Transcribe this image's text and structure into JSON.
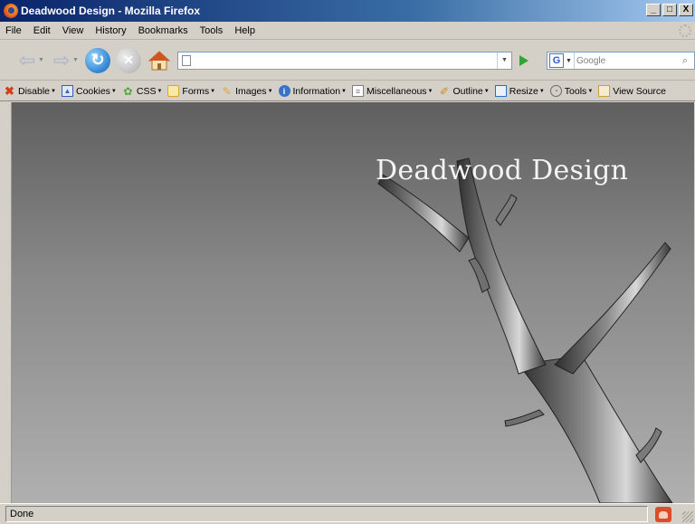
{
  "window": {
    "title": "Deadwood Design - Mozilla Firefox",
    "controls": [
      "_",
      "□",
      "X"
    ]
  },
  "menu": {
    "items": [
      "File",
      "Edit",
      "View",
      "History",
      "Bookmarks",
      "Tools",
      "Help"
    ]
  },
  "navigation": {
    "url_value": "",
    "search_placeholder": "Google",
    "search_engine_icon": "google-icon"
  },
  "dev_toolbar": {
    "items": [
      {
        "label": "Disable",
        "icon": "disable-icon",
        "color": "#d83c1b"
      },
      {
        "label": "Cookies",
        "icon": "cookies-icon",
        "color": "#3a5fb0"
      },
      {
        "label": "CSS",
        "icon": "css-icon",
        "color": "#4fa83a"
      },
      {
        "label": "Forms",
        "icon": "forms-icon",
        "color": "#d9a531"
      },
      {
        "label": "Images",
        "icon": "images-icon",
        "color": "#e2a62c"
      },
      {
        "label": "Information",
        "icon": "information-icon",
        "color": "#3a72c7"
      },
      {
        "label": "Miscellaneous",
        "icon": "miscellaneous-icon",
        "color": "#7d7d7d"
      },
      {
        "label": "Outline",
        "icon": "outline-icon",
        "color": "#d08b1c"
      },
      {
        "label": "Resize",
        "icon": "resize-icon",
        "color": "#2b6fc2"
      },
      {
        "label": "Tools",
        "icon": "tools-icon",
        "color": "#6a6a6a"
      },
      {
        "label": "View Source",
        "icon": "view-source-icon",
        "color": "#c7a13a"
      }
    ]
  },
  "page": {
    "site_title": "Deadwood Design"
  },
  "status": {
    "text": "Done"
  },
  "colors": {
    "titlebar_start": "#0a246a",
    "titlebar_end": "#a6caf0",
    "chrome": "#d4d0c8"
  }
}
